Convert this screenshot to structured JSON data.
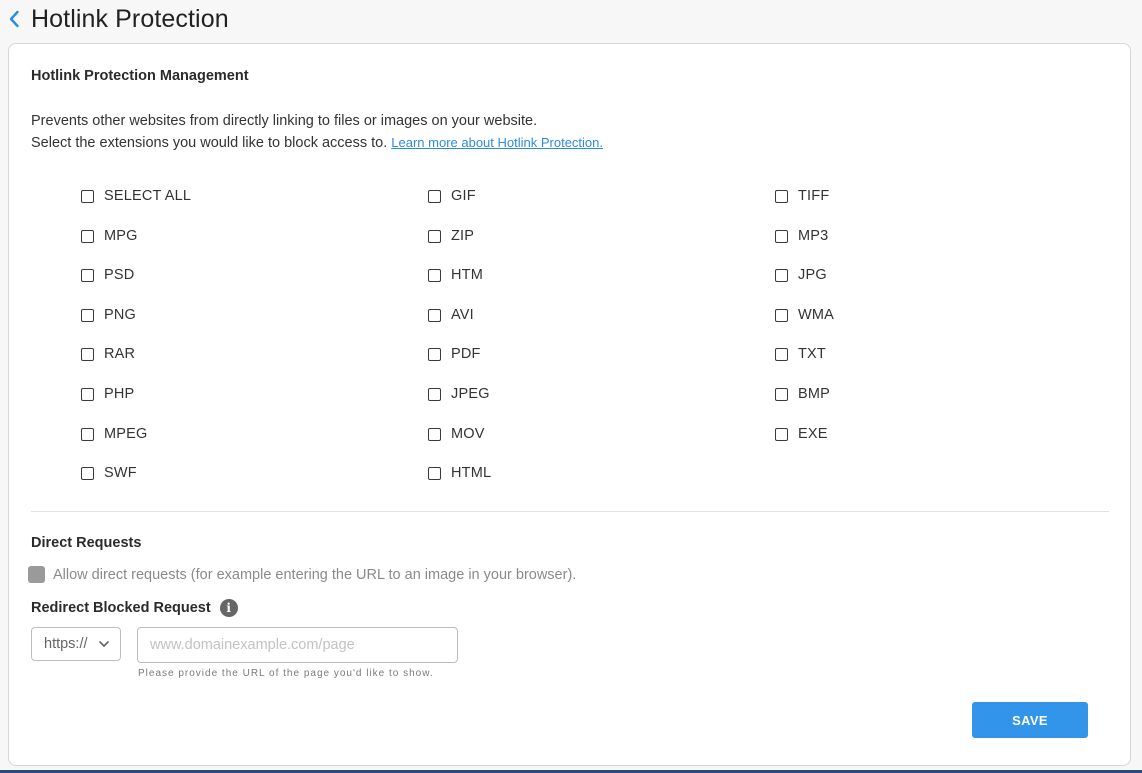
{
  "header": {
    "title": "Hotlink Protection",
    "back_icon": "chevron-left-icon",
    "accent": "#2d8ae0"
  },
  "management": {
    "title": "Hotlink Protection Management",
    "description_line1": "Prevents other websites from directly linking to files or images on your website.",
    "description_line2": "Select the extensions you would like to block access to.",
    "learn_more_link": "Learn more about Hotlink Protection."
  },
  "extensions": {
    "columns": [
      [
        {
          "label": "SELECT ALL",
          "checked": false
        },
        {
          "label": "MPG",
          "checked": false
        },
        {
          "label": "PSD",
          "checked": false
        },
        {
          "label": "PNG",
          "checked": false
        },
        {
          "label": "RAR",
          "checked": false
        },
        {
          "label": "PHP",
          "checked": false
        },
        {
          "label": "MPEG",
          "checked": false
        },
        {
          "label": "SWF",
          "checked": false
        }
      ],
      [
        {
          "label": "GIF",
          "checked": false
        },
        {
          "label": "ZIP",
          "checked": false
        },
        {
          "label": "HTM",
          "checked": false
        },
        {
          "label": "AVI",
          "checked": false
        },
        {
          "label": "PDF",
          "checked": false
        },
        {
          "label": "JPEG",
          "checked": false
        },
        {
          "label": "MOV",
          "checked": false
        },
        {
          "label": "HTML",
          "checked": false
        }
      ],
      [
        {
          "label": "TIFF",
          "checked": false
        },
        {
          "label": "MP3",
          "checked": false
        },
        {
          "label": "JPG",
          "checked": false
        },
        {
          "label": "WMA",
          "checked": false
        },
        {
          "label": "TXT",
          "checked": false
        },
        {
          "label": "BMP",
          "checked": false
        },
        {
          "label": "EXE",
          "checked": false
        }
      ]
    ]
  },
  "direct_requests": {
    "title": "Direct Requests",
    "allow_label": "Allow direct requests (for example entering the URL to an image in your browser).",
    "allow_checked": false,
    "allow_disabled": true
  },
  "redirect": {
    "title": "Redirect Blocked Request",
    "info_icon": "info-icon",
    "protocol_value": "https://",
    "url_placeholder": "www.domainexample.com/page",
    "url_value": "",
    "helper_text": "Please provide the URL of the page you'd like to show."
  },
  "actions": {
    "save_label": "SAVE",
    "save_color": "#3395ea"
  }
}
